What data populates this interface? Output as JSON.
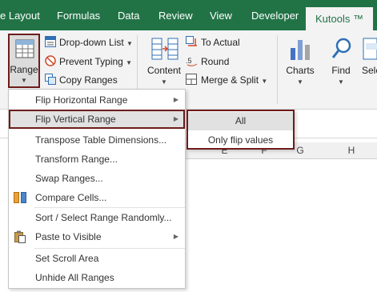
{
  "tabs": [
    "e Layout",
    "Formulas",
    "Data",
    "Review",
    "View",
    "Developer",
    "Kutools ™"
  ],
  "ribbon": {
    "range_label": "Range",
    "dropdown_list": "Drop-down List",
    "prevent_typing": "Prevent Typing",
    "copy_ranges": "Copy Ranges",
    "content_label": "Content",
    "to_actual": "To Actual",
    "round": "Round",
    "merge_split": "Merge & Split",
    "charts": "Charts",
    "find": "Find",
    "select": "Sele"
  },
  "columns": [
    "E",
    "F",
    "G",
    "H"
  ],
  "menu": {
    "items": [
      {
        "label": "Flip Horizontal Range",
        "submenu": true
      },
      {
        "label": "Flip Vertical Range",
        "submenu": true
      },
      {
        "label": "Transpose Table Dimensions...",
        "submenu": false
      },
      {
        "label": "Transform Range...",
        "submenu": false
      },
      {
        "label": "Swap Ranges...",
        "submenu": false
      },
      {
        "label": "Compare Cells...",
        "submenu": false
      },
      {
        "label": "Sort / Select Range Randomly...",
        "submenu": false
      },
      {
        "label": "Paste to Visible",
        "submenu": true
      },
      {
        "label": "Set Scroll Area",
        "submenu": false
      },
      {
        "label": "Unhide All Ranges",
        "submenu": false
      }
    ]
  },
  "submenu": {
    "items": [
      "All",
      "Only flip values"
    ]
  },
  "colors": {
    "ribbon_green": "#217346",
    "highlight_border": "#6e1c1c",
    "hover_bg": "#e1e1e1"
  },
  "icons": [
    "range-grid-icon",
    "dropdown-list-icon",
    "prevent-typing-icon",
    "copy-ranges-icon",
    "content-icon",
    "to-actual-icon",
    "round-icon",
    "merge-split-icon",
    "charts-icon",
    "find-icon",
    "compare-cells-icon",
    "paste-icon"
  ]
}
